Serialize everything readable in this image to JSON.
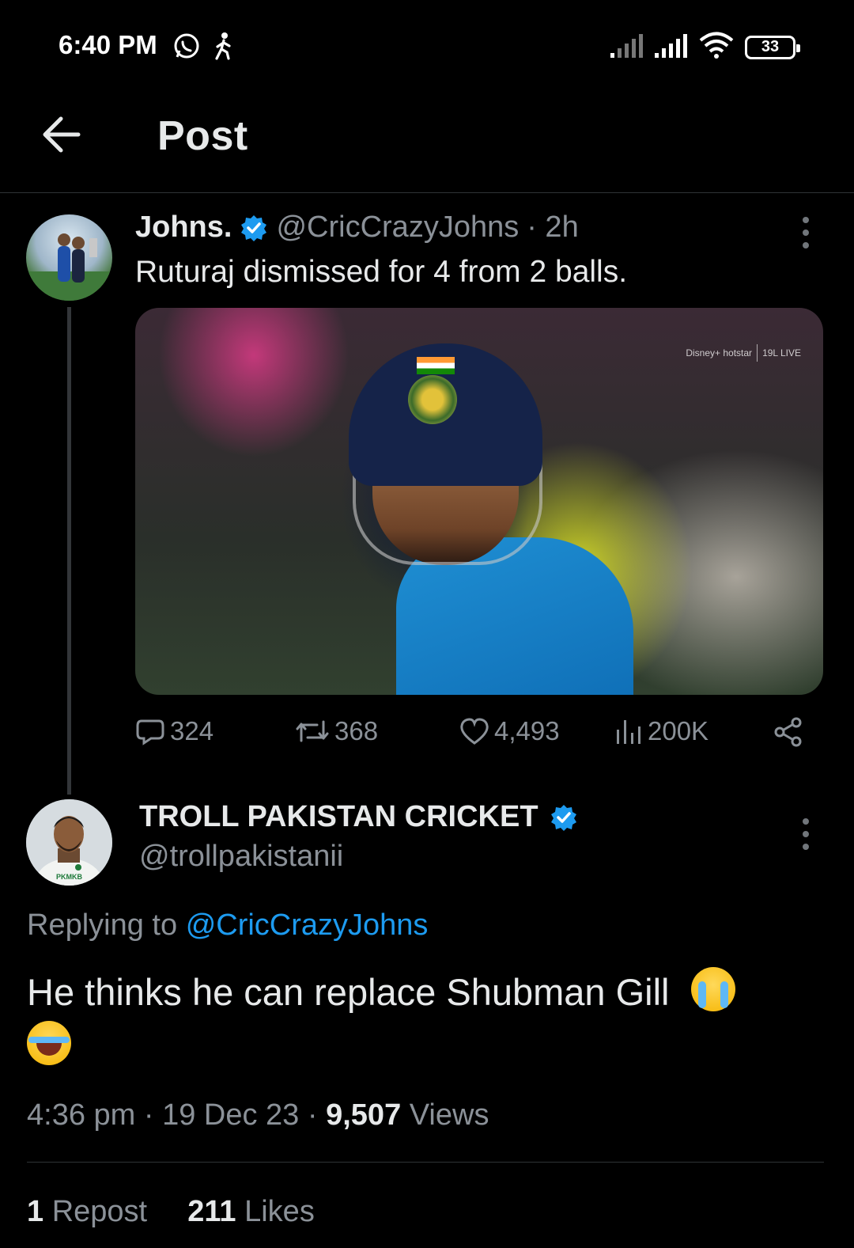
{
  "status_bar": {
    "time": "6:40 PM",
    "battery": "33",
    "icons": [
      "whatsapp-icon",
      "walking-icon",
      "signal-icon",
      "signal-icon",
      "wifi-icon",
      "battery-icon"
    ]
  },
  "header": {
    "title": "Post"
  },
  "tweet": {
    "name": "Johns.",
    "handle": "@CricCrazyJohns",
    "time": "· 2h",
    "text": "Ruturaj dismissed for 4 from 2 balls.",
    "media": {
      "watermark_brand": "Disney+ hotstar",
      "watermark_live": "19L LIVE"
    },
    "actions": {
      "replies": "324",
      "reposts": "368",
      "likes": "4,493",
      "views": "200K"
    }
  },
  "reply": {
    "name": "TROLL PAKISTAN CRICKET",
    "handle": "@trollpakistanii",
    "replying_prefix": "Replying to",
    "replying_mention": "@CricCrazyJohns",
    "text": "He thinks he can replace Shubman Gill",
    "time": "4:36 pm",
    "date": "19 Dec 23",
    "views_count": "9,507",
    "views_label": "Views",
    "reposts_count": "1",
    "reposts_label": "Repost",
    "likes_count": "211",
    "likes_label": "Likes",
    "avatar_jersey_text": "PKMKB"
  },
  "colors": {
    "background": "#000000",
    "text_primary": "#e7e9ea",
    "text_secondary": "#8b9198",
    "accent": "#1d9bf0",
    "divider": "#2f3336"
  }
}
